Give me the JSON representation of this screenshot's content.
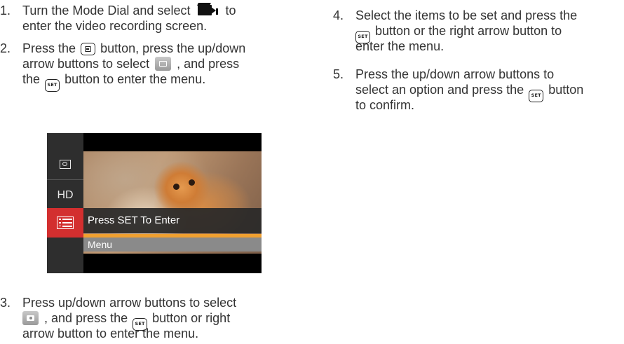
{
  "steps": [
    {
      "num": "1.",
      "lines": [
        "Turn the Mode Dial and select",
        "to",
        "enter the video recording screen."
      ]
    },
    {
      "num": "2.",
      "lines": [
        "Press the",
        "button, press the up/down",
        "arrow buttons to select",
        ", and press",
        "the",
        "button to enter the menu."
      ]
    },
    {
      "num": "3.",
      "lines": [
        "Press up/down arrow buttons to select",
        ", and press the",
        "button or right",
        "arrow button to enter the menu."
      ]
    },
    {
      "num": "4.",
      "lines": [
        "Select the items to be set and press the",
        "button or the right arrow button to",
        "enter the menu."
      ]
    },
    {
      "num": "5.",
      "lines": [
        "Press the up/down arrow buttons to",
        "select an option and press the",
        "button",
        "to confirm."
      ]
    }
  ],
  "key_label": "SET",
  "screen": {
    "sidebar": [
      {
        "icon": "scene-icon",
        "label": ""
      },
      {
        "icon": "hd-icon",
        "label": "HD"
      },
      {
        "icon": "color-effect-icon",
        "label": ""
      },
      {
        "icon": "menu-list-icon",
        "label": "",
        "selected": true
      }
    ],
    "hint": "Press SET To Enter",
    "menu_label": "Menu",
    "colors": {
      "selected": "#d32f2f",
      "accent": "#f0a030"
    }
  }
}
